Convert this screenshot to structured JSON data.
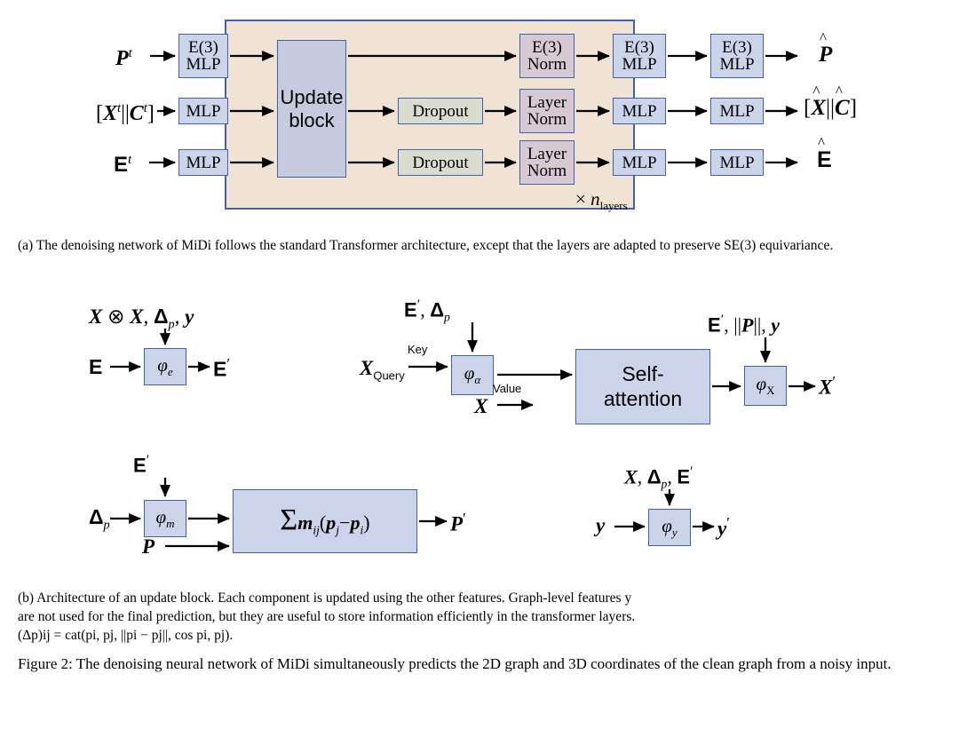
{
  "figure": {
    "number": "Figure 2:",
    "main_caption": "Figure 2:  The denoising neural network of MiDi simultaneously predicts the 2D graph and 3D coordinates of the clean graph from a noisy input."
  },
  "colors": {
    "box_blue_fill": "#ccd4ea",
    "box_blue_border": "#3f63ab",
    "box_green_fill": "#d9ddcd",
    "box_mauve_fill": "#d6c9d3",
    "update_block_fill": "#c5cade",
    "container_beige_fill": "#f1e3d3",
    "page_background": "#ffffff"
  },
  "panel_a": {
    "inputs": [
      {
        "id": "input-positions",
        "label": "P t"
      },
      {
        "id": "input-node-features",
        "label": "[X t||C t]"
      },
      {
        "id": "input-edge-features",
        "label": "E t"
      }
    ],
    "input_mlps": [
      {
        "id": "mlp-pos-in",
        "line1": "E(3)",
        "line2": "MLP"
      },
      {
        "id": "mlp-node-in",
        "line1": "MLP",
        "line2": ""
      },
      {
        "id": "mlp-edge-in",
        "line1": "MLP",
        "line2": ""
      }
    ],
    "update_block": {
      "line1": "Update",
      "line2": "block"
    },
    "dropouts": [
      {
        "id": "dropout-node",
        "label": "Dropout"
      },
      {
        "id": "dropout-edge",
        "label": "Dropout"
      }
    ],
    "norms": [
      {
        "id": "norm-pos",
        "line1": "E(3)",
        "line2": "Norm"
      },
      {
        "id": "norm-node",
        "line1": "Layer",
        "line2": "Norm"
      },
      {
        "id": "norm-edge",
        "line1": "Layer",
        "line2": "Norm"
      }
    ],
    "mid_mlps": [
      {
        "id": "mlp-pos-mid",
        "line1": "E(3)",
        "line2": "MLP"
      },
      {
        "id": "mlp-node-mid",
        "line1": "MLP",
        "line2": ""
      },
      {
        "id": "mlp-edge-mid",
        "line1": "MLP",
        "line2": ""
      }
    ],
    "out_mlps": [
      {
        "id": "mlp-pos-out",
        "line1": "E(3)",
        "line2": "MLP"
      },
      {
        "id": "mlp-node-out",
        "line1": "MLP",
        "line2": ""
      },
      {
        "id": "mlp-edge-out",
        "line1": "MLP",
        "line2": ""
      }
    ],
    "outputs": [
      {
        "id": "output-positions",
        "label": "P̂"
      },
      {
        "id": "output-node-features",
        "label": "[X̂||Ĉ]"
      },
      {
        "id": "output-edge-features",
        "label": "Ê"
      }
    ],
    "repeat_label": "× n layers",
    "caption": "(a) The denoising network of MiDi follows the standard Transformer architecture, except that the layers are adapted to preserve SE(3) equivariance."
  },
  "panel_b": {
    "edge_update": {
      "top_inputs": "X ⊗ X, Δp, y",
      "left_input": "E",
      "box_label": "φe",
      "output": "E ′"
    },
    "node_update": {
      "top_inputs": "E ′, Δp",
      "key_label": "Key",
      "query_label": "Query",
      "value_label": "Value",
      "key_input": "X",
      "value_input": "X",
      "phi_alpha_label": "φα",
      "attention_line1": "Self-",
      "attention_line2": "attention",
      "right_top_inputs": "E ′, ||P||, y",
      "phi_x_label": "φX",
      "output": "X ′"
    },
    "position_update": {
      "top_inputs": "E ′",
      "left_input": "Δp",
      "phi_m_label": "φm",
      "second_input": "P",
      "sum_formula": "Σ mij ( pj − pi )",
      "output": "P ′"
    },
    "graph_update": {
      "top_inputs": "X, Δp, E ′",
      "left_input": "y",
      "phi_y_label": "φy",
      "output": "y ′"
    },
    "caption_line1": "(b) Architecture of an update block. Each component is updated using the other features. Graph-level features y",
    "caption_line2": "are not used for the final prediction, but they are useful to store information efficiently in the transformer layers.",
    "caption_line3": "(Δp)ij = cat(pi, pj, ||pi − pj||, cos pi, pj)."
  }
}
